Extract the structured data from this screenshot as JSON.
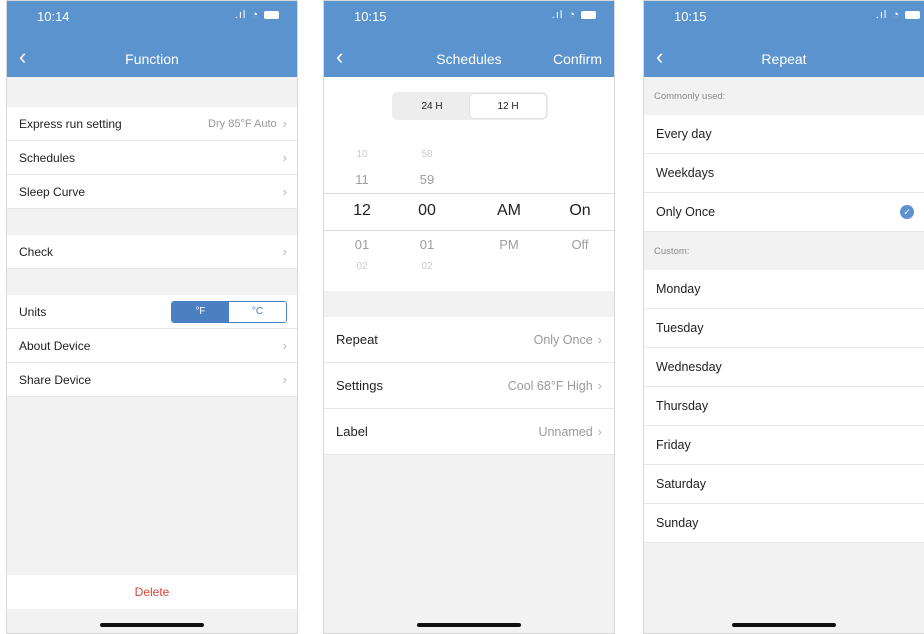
{
  "function_screen": {
    "status_time": "10:14",
    "title": "Function",
    "rows_group1": [
      {
        "label": "Express run setting",
        "value": "Dry 85°F Auto"
      },
      {
        "label": "Schedules",
        "value": ""
      },
      {
        "label": "Sleep Curve",
        "value": ""
      }
    ],
    "check_label": "Check",
    "units_label": "Units",
    "units_options": [
      "°F",
      "°C"
    ],
    "units_selected": "°F",
    "rows_group3": [
      {
        "label": "About Device"
      },
      {
        "label": "Share Device"
      }
    ],
    "delete_label": "Delete"
  },
  "schedules_screen": {
    "status_time": "10:15",
    "title": "Schedules",
    "confirm_label": "Confirm",
    "segment": [
      "24 H",
      "12 H"
    ],
    "segment_selected": "12 H",
    "picker": {
      "hours": [
        "10",
        "11",
        "12",
        "01",
        "02"
      ],
      "minutes": [
        "58",
        "59",
        "00",
        "01",
        "02"
      ],
      "ampm": [
        "AM",
        "PM"
      ],
      "onoff": [
        "On",
        "Off"
      ]
    },
    "rows": [
      {
        "label": "Repeat",
        "value": "Only Once"
      },
      {
        "label": "Settings",
        "value": "Cool 68°F High"
      },
      {
        "label": "Label",
        "value": "Unnamed"
      }
    ]
  },
  "repeat_screen": {
    "status_time": "10:15",
    "title": "Repeat",
    "commonly_used_label": "Commonly used:",
    "common": [
      "Every day",
      "Weekdays",
      "Only Once"
    ],
    "selected": "Only Once",
    "custom_label": "Custom:",
    "custom": [
      "Monday",
      "Tuesday",
      "Wednesday",
      "Thursday",
      "Friday",
      "Saturday",
      "Sunday"
    ]
  },
  "colors": {
    "header": "#5b93cf",
    "accent": "#4a7fc1",
    "delete": "#d9433a"
  }
}
